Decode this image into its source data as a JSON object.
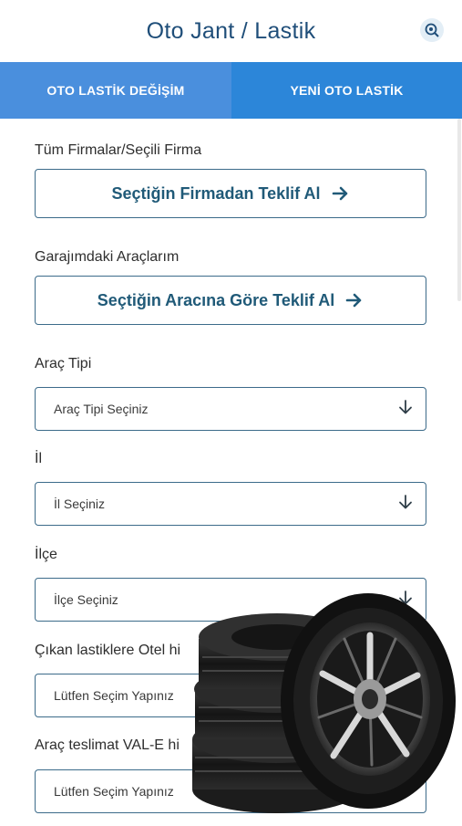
{
  "header": {
    "title": "Oto Jant / Lastik",
    "icon": "search-settings-icon"
  },
  "tabs": [
    {
      "label": "OTO LASTİK DEĞİŞİM",
      "active": true
    },
    {
      "label": "YENİ OTO LASTİK",
      "active": false
    }
  ],
  "colors": {
    "header_title": "#1f4e79",
    "tab_active": "#4a8fdd",
    "tab_inactive": "#2c86d9",
    "button_text": "#205a78",
    "border": "#3c6b8a"
  },
  "form": {
    "company_section": {
      "label": "Tüm Firmalar/Seçili Firma",
      "button_label": "Seçtiğin Firmadan Teklif Al"
    },
    "garage_section": {
      "label": "Garajımdaki Araçlarım",
      "button_label": "Seçtiğin Aracına Göre Teklif Al"
    },
    "vehicle_type": {
      "label": "Araç Tipi",
      "value": "Araç Tipi Seçiniz"
    },
    "city": {
      "label": "İl",
      "value": "İl Seçiniz"
    },
    "district": {
      "label": "İlçe",
      "value": "İlçe Seçiniz"
    },
    "tire_hotel": {
      "label": "Çıkan lastiklere Otel hi",
      "value": "Lütfen Seçim Yapınız"
    },
    "valet": {
      "label": "Araç teslimat VAL-E hi",
      "value": "Lütfen Seçim Yapınız"
    }
  }
}
